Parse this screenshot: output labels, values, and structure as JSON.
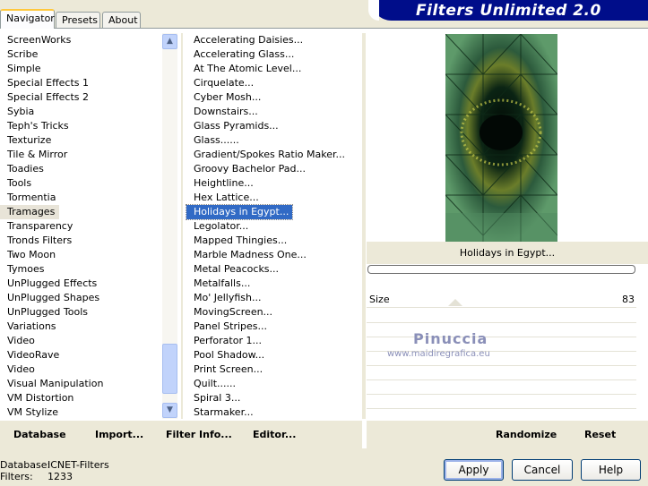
{
  "tabs": [
    {
      "label": "Navigator"
    },
    {
      "label": "Presets"
    },
    {
      "label": "About"
    }
  ],
  "app_title": "Filters Unlimited 2.0",
  "categories": [
    "ScreenWorks",
    "Scribe",
    "Simple",
    "Special Effects 1",
    "Special Effects 2",
    "Sybia",
    "Teph's Tricks",
    "Texturize",
    "Tile & Mirror",
    "Toadies",
    "Tools",
    "Tormentia",
    "Tramages",
    "Transparency",
    "Tronds Filters",
    "Two Moon",
    "Tymoes",
    "UnPlugged Effects",
    "UnPlugged Shapes",
    "UnPlugged Tools",
    "Variations",
    "Video",
    "VideoRave",
    "Video",
    "Visual Manipulation",
    "VM Distortion",
    "VM Stylize"
  ],
  "selected_category": "Tramages",
  "filters": [
    "Accelerating Daisies...",
    "Accelerating Glass...",
    "At The Atomic Level...",
    "Cirquelate...",
    "Cyber Mosh...",
    "Downstairs...",
    "Glass Pyramids...",
    "Glass......",
    "Gradient/Spokes Ratio Maker...",
    "Groovy Bachelor Pad...",
    "Heightline...",
    "Hex Lattice...",
    "Holidays in Egypt...",
    "Legolator...",
    "Mapped Thingies...",
    "Marble Madness One...",
    "Metal Peacocks...",
    "Metalfalls...",
    "Mo' Jellyfish...",
    "MovingScreen...",
    "Panel Stripes...",
    "Perforator 1...",
    "Pool Shadow...",
    "Print Screen...",
    "Quilt......",
    "Spiral 3...",
    "Starmaker..."
  ],
  "selected_filter": "Holidays in Egypt...",
  "preview_caption": "Holidays in Egypt...",
  "param": {
    "label": "Size",
    "value": "83"
  },
  "watermark": {
    "name": "Pinuccia",
    "url": "www.maidiregrafica.eu"
  },
  "left_buttons": {
    "database": "Database",
    "import": "Import...",
    "filter_info": "Filter Info...",
    "editor": "Editor..."
  },
  "right_buttons": {
    "randomize": "Randomize",
    "reset": "Reset"
  },
  "status": {
    "database_label": "Database:",
    "database_value": "ICNET-Filters",
    "filters_label": "Filters:",
    "filters_value": "1233"
  },
  "dialog_buttons": {
    "apply": "Apply",
    "cancel": "Cancel",
    "help": "Help"
  },
  "colors": {
    "selection": "#316ac5",
    "banner": "#000d8a",
    "dialog_bg": "#ece9d8"
  }
}
